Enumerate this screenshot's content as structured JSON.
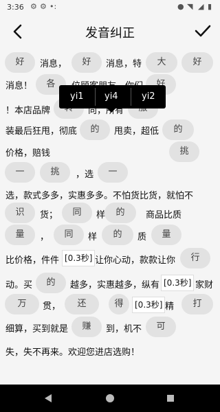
{
  "status": {
    "time": "3:36"
  },
  "header": {
    "title": "发音纠正"
  },
  "popup": {
    "options": [
      "yi1",
      "yi4",
      "yi2"
    ]
  },
  "pills": [
    "好",
    "好",
    "大",
    "好",
    "各",
    "好",
    "转",
    "服",
    "的",
    "的",
    "挑",
    "一",
    "挑",
    "一",
    "识",
    "同",
    "的",
    "量",
    "同",
    "的",
    "量",
    "行",
    "的",
    "万",
    "还",
    "得",
    "打",
    "赚",
    "可"
  ],
  "text": [
    "消息，",
    "消息，特",
    "消息！",
    "位顾客朋友，你们",
    "！本店品牌",
    "向，所有",
    "装最后狂甩，彻底",
    "甩卖，超低",
    "价格，赔钱",
    "，选",
    "选，款式多多，实惠多多。不怕货比货，就怕不",
    "货；",
    "样",
    "商品比质",
    "，",
    "样",
    "质",
    "比价格，件件",
    "让你心动，款款让你",
    "动。买",
    "越多，实惠越多，纵有",
    "家财",
    "贯，",
    "精",
    "细算，买到就是",
    "到，机不",
    "失，失不再来。欢迎您进店选购！"
  ],
  "tags": [
    "[0.3秒]",
    "[0.3秒]",
    "[0.3秒]",
    "[0.3秒]"
  ]
}
